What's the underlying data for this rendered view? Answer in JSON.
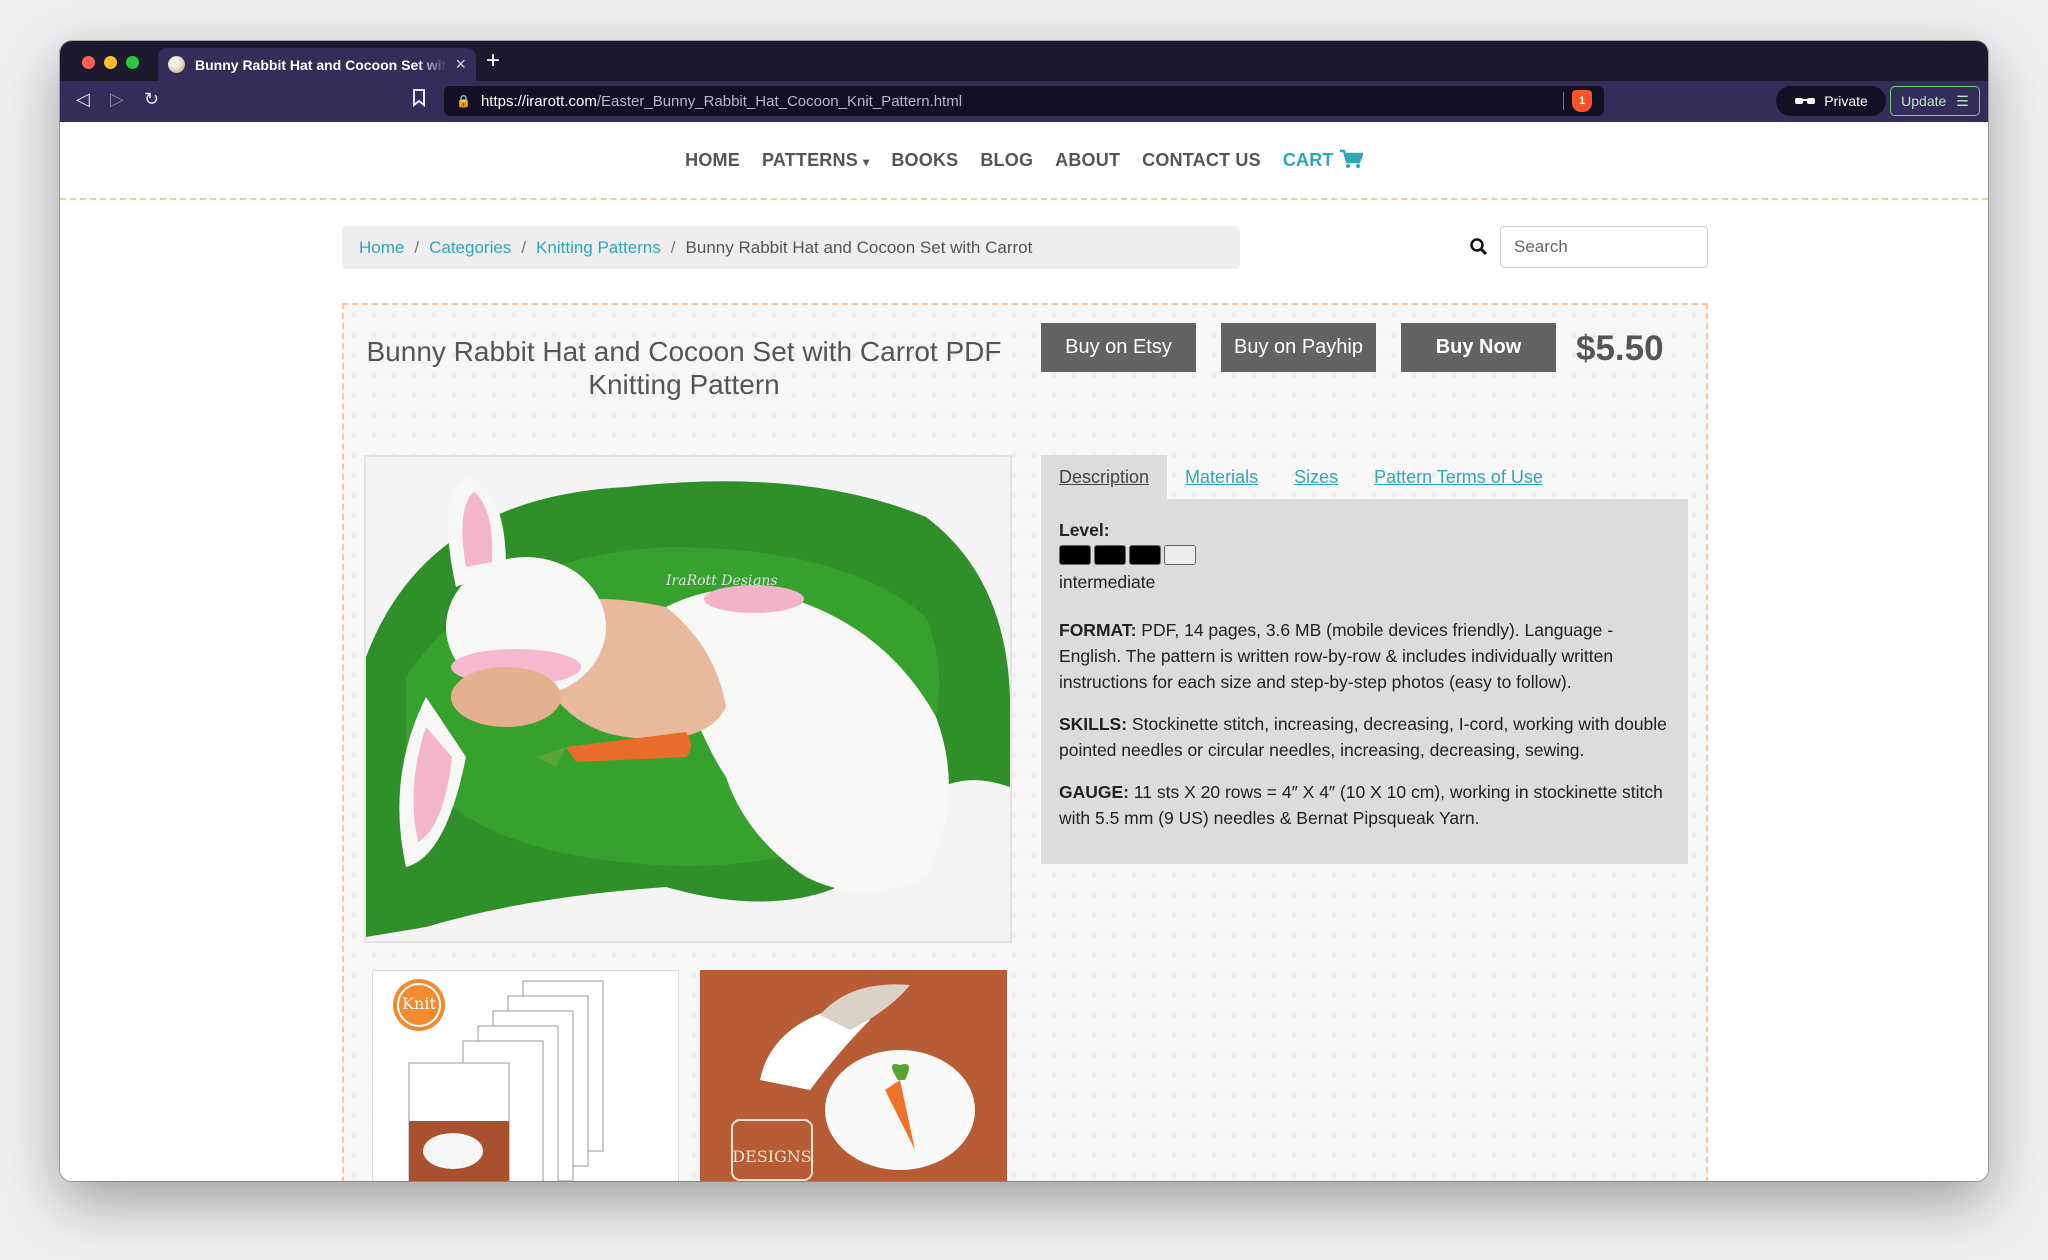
{
  "browser": {
    "tab_title": "Bunny Rabbit Hat and Cocoon Set with Carrot",
    "url_host": "https://irarott.com",
    "url_path": "/Easter_Bunny_Rabbit_Hat_Cocoon_Knit_Pattern.html",
    "shield_count": "1",
    "private_label": "Private",
    "update_label": "Update"
  },
  "nav": {
    "home": "HOME",
    "patterns": "PATTERNS",
    "books": "BOOKS",
    "blog": "BLOG",
    "about": "ABOUT",
    "contact": "CONTACT US",
    "cart": "CART"
  },
  "breadcrumb": {
    "home": "Home",
    "categories": "Categories",
    "knitting": "Knitting Patterns",
    "current": "Bunny Rabbit Hat and Cocoon Set with Carrot"
  },
  "search": {
    "placeholder": "Search"
  },
  "product": {
    "title": "Bunny Rabbit Hat and Cocoon Set with Carrot PDF Knitting Pattern",
    "buy_etsy": "Buy on Etsy",
    "buy_payhip": "Buy on Payhip",
    "buy_now": "Buy Now",
    "price": "$5.50",
    "photo_watermark": "IraRott Designs",
    "thumb1_badge": "Knit",
    "thumb2_logo": "DESIGNS"
  },
  "tabs": {
    "description": "Description",
    "materials": "Materials",
    "sizes": "Sizes",
    "terms": "Pattern Terms of Use"
  },
  "details": {
    "level_label": "Level:",
    "level_filled": 3,
    "level_total": 4,
    "level_text": "intermediate",
    "format_label": "FORMAT:",
    "format_text": " PDF, 14 pages, 3.6 MB (mobile devices friendly). Language - English. The pattern is written row-by-row & includes individually written instructions for each size and step-by-step photos (easy to follow).",
    "skills_label": "SKILLS:",
    "skills_text": " Stockinette stitch, increasing, decreasing, I-cord, working with double pointed needles or circular needles, increasing, decreasing, sewing.",
    "gauge_label": "GAUGE:",
    "gauge_text": " 11 sts X 20 rows = 4″ X 4″ (10 X 10 cm), working in stockinette stitch with 5.5 mm (9 US) needles & Bernat Pipsqueak Yarn."
  },
  "colors": {
    "accent": "#30a7b5",
    "button": "#636363",
    "chrome": "#342c59",
    "dashed_border": "#f6c89b"
  }
}
